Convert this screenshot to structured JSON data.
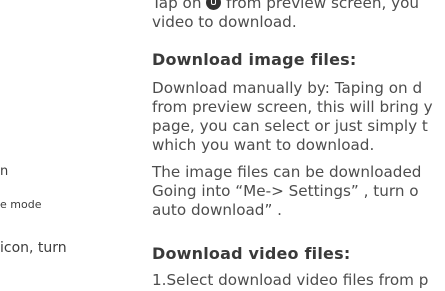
{
  "left_column": {
    "fragment_1": "n",
    "fragment_2": "e mode",
    "fragment_3": "icon, turn"
  },
  "right_column": {
    "intro_before_icon": "Tap on ",
    "intro_icon": "download-icon",
    "intro_after_icon": " from preview screen, you",
    "intro_line_2": "video to download.",
    "heading_images": "Download image files:",
    "images_para_1": [
      "Download manually by: Taping on d",
      "from preview screen, this will bring y",
      "page, you can select or just simply t",
      "which you want to download."
    ],
    "images_para_2": [
      "The image files can be downloaded",
      "Going into  “Me-> Settings” , turn o",
      "auto download” ."
    ],
    "heading_videos": "Download video files:",
    "videos_para_1": "1.Select download video files from p"
  }
}
